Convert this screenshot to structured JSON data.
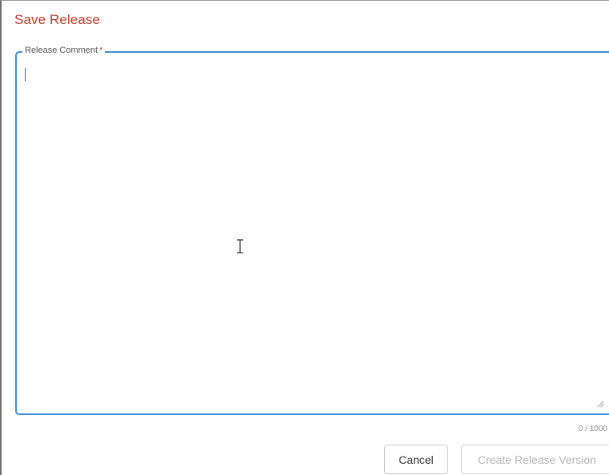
{
  "dialog": {
    "title": "Save Release",
    "field": {
      "label": "Release Comment",
      "required_mark": "*",
      "value": "",
      "counter": "0 / 1000"
    },
    "buttons": {
      "cancel_label": "Cancel",
      "create_label": "Create Release Version",
      "create_disabled": true
    }
  },
  "colors": {
    "title": "#c0392b",
    "field_border_focus": "#3d8fd6",
    "required": "#c0392b",
    "disabled_text": "#b4b4b4"
  },
  "icons": {
    "resize": "resize-handle-icon",
    "cursor": "text-cursor-icon"
  }
}
